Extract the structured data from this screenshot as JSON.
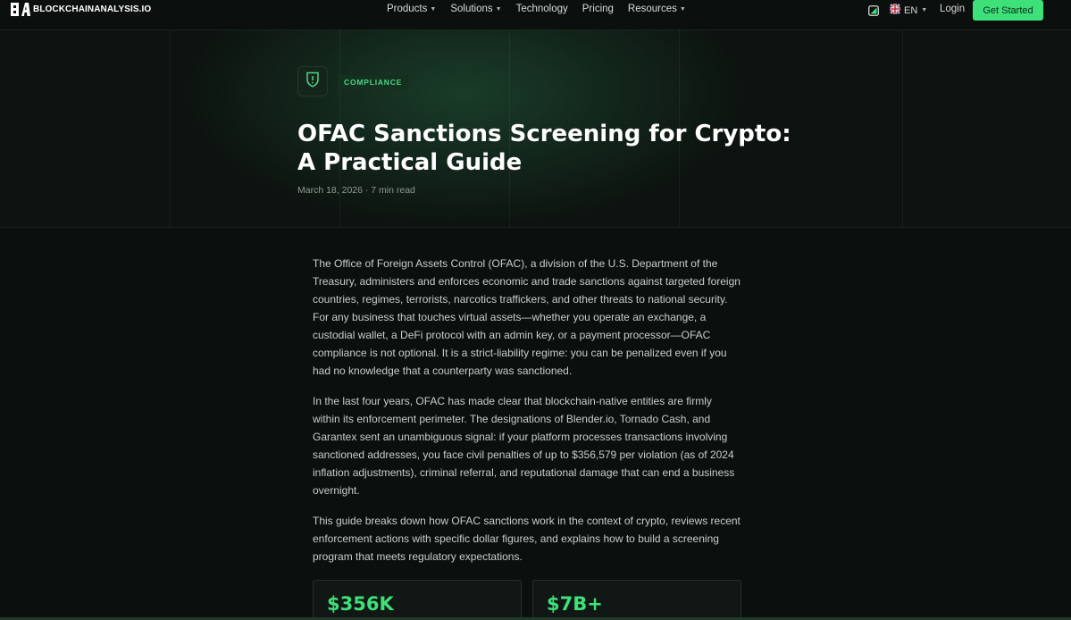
{
  "brand": {
    "name_main": "BLOCKCHAINANALYSIS",
    "name_suffix": ".IO"
  },
  "nav": {
    "items": [
      {
        "label": "Products",
        "has_dropdown": true
      },
      {
        "label": "Solutions",
        "has_dropdown": true
      },
      {
        "label": "Technology",
        "has_dropdown": false
      },
      {
        "label": "Pricing",
        "has_dropdown": false
      },
      {
        "label": "Resources",
        "has_dropdown": true
      }
    ],
    "language": "EN",
    "login": "Login",
    "cta": "Get Started"
  },
  "hero": {
    "category": "COMPLIANCE",
    "title": "OFAC Sanctions Screening for Crypto: A Practical Guide",
    "meta": "March 18, 2026 · 7 min read"
  },
  "article": {
    "paragraphs": [
      "The Office of Foreign Assets Control (OFAC), a division of the U.S. Department of the Treasury, administers and enforces economic and trade sanctions against targeted foreign countries, regimes, terrorists, narcotics traffickers, and other threats to national security. For any business that touches virtual assets—whether you operate an exchange, a custodial wallet, a DeFi protocol with an admin key, or a payment processor—OFAC compliance is not optional. It is a strict-liability regime: you can be penalized even if you had no knowledge that a counterparty was sanctioned.",
      "In the last four years, OFAC has made clear that blockchain-native entities are firmly within its enforcement perimeter. The designations of Blender.io, Tornado Cash, and Garantex sent an unambiguous signal: if your platform processes transactions involving sanctioned addresses, you face civil penalties of up to $356,579 per violation (as of 2024 inflation adjustments), criminal referral, and reputational damage that can end a business overnight.",
      "This guide breaks down how OFAC sanctions work in the context of crypto, reviews recent enforcement actions with specific dollar figures, and explains how to build a screening program that meets regulatory expectations."
    ]
  },
  "stats": [
    {
      "value": "$356K"
    },
    {
      "value": "$7B+"
    }
  ],
  "colors": {
    "accent": "#3ee07a",
    "background": "#0b0f0d"
  }
}
